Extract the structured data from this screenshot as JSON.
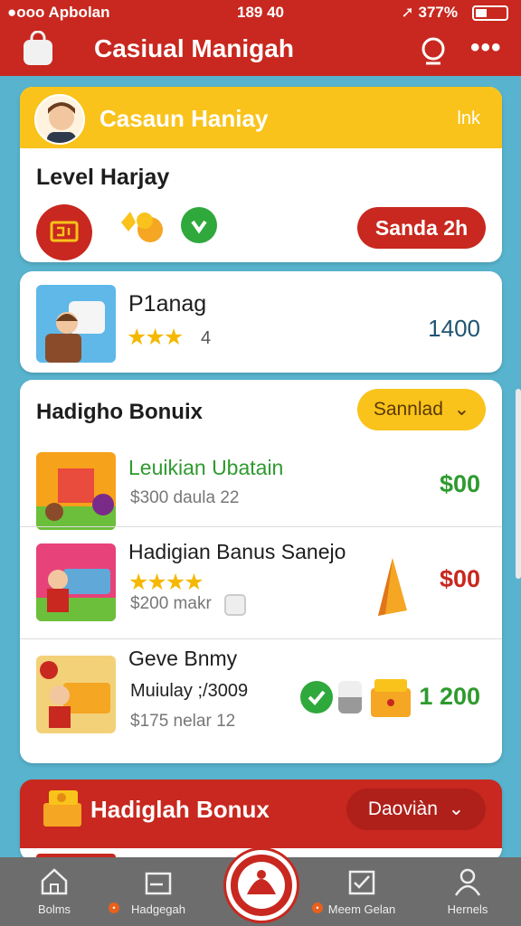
{
  "status": {
    "left": "●ooo Apbolan",
    "time": "189 40",
    "right": "➚ 377%"
  },
  "appbar": {
    "title": "Casiual Manigah",
    "icons": [
      "bag-icon",
      "search-icon",
      "more-icon"
    ]
  },
  "profile": {
    "title": "Casaun Haniay",
    "link": "lnk",
    "level": "Level Harjay",
    "button": "Sanda 2h"
  },
  "featured": {
    "name": "P1anag",
    "stars": "★★★",
    "rating": "4",
    "price": "1400"
  },
  "bonus": {
    "title": "Hadigho Bonuix",
    "dropdown": "Sannlad",
    "items": [
      {
        "name": "Leuikian Ubatain",
        "sub": "$300 daula  22",
        "price": "$00",
        "price_color": "#2e9a2e"
      },
      {
        "name": "Hadigian Banus Sanejo",
        "stars": "★★★★",
        "sub": "$200 makr",
        "price": "$00",
        "price_color": "#c8281f"
      },
      {
        "name": "Geve Bnmy",
        "sub1": "Muiulay ;/3009",
        "sub": "$175 nelar  12",
        "price": "1 200",
        "price_color": "#2e9a2e"
      }
    ]
  },
  "promo": {
    "title": "Hadiglah Bonux",
    "dropdown": "Daoviàn"
  },
  "nav": [
    "Bolms",
    "Hadgegah",
    "Meem Gelan",
    "Hernels"
  ],
  "colors": {
    "primary": "#c8281f",
    "accent": "#f9c31b",
    "background": "#58b4ce"
  }
}
